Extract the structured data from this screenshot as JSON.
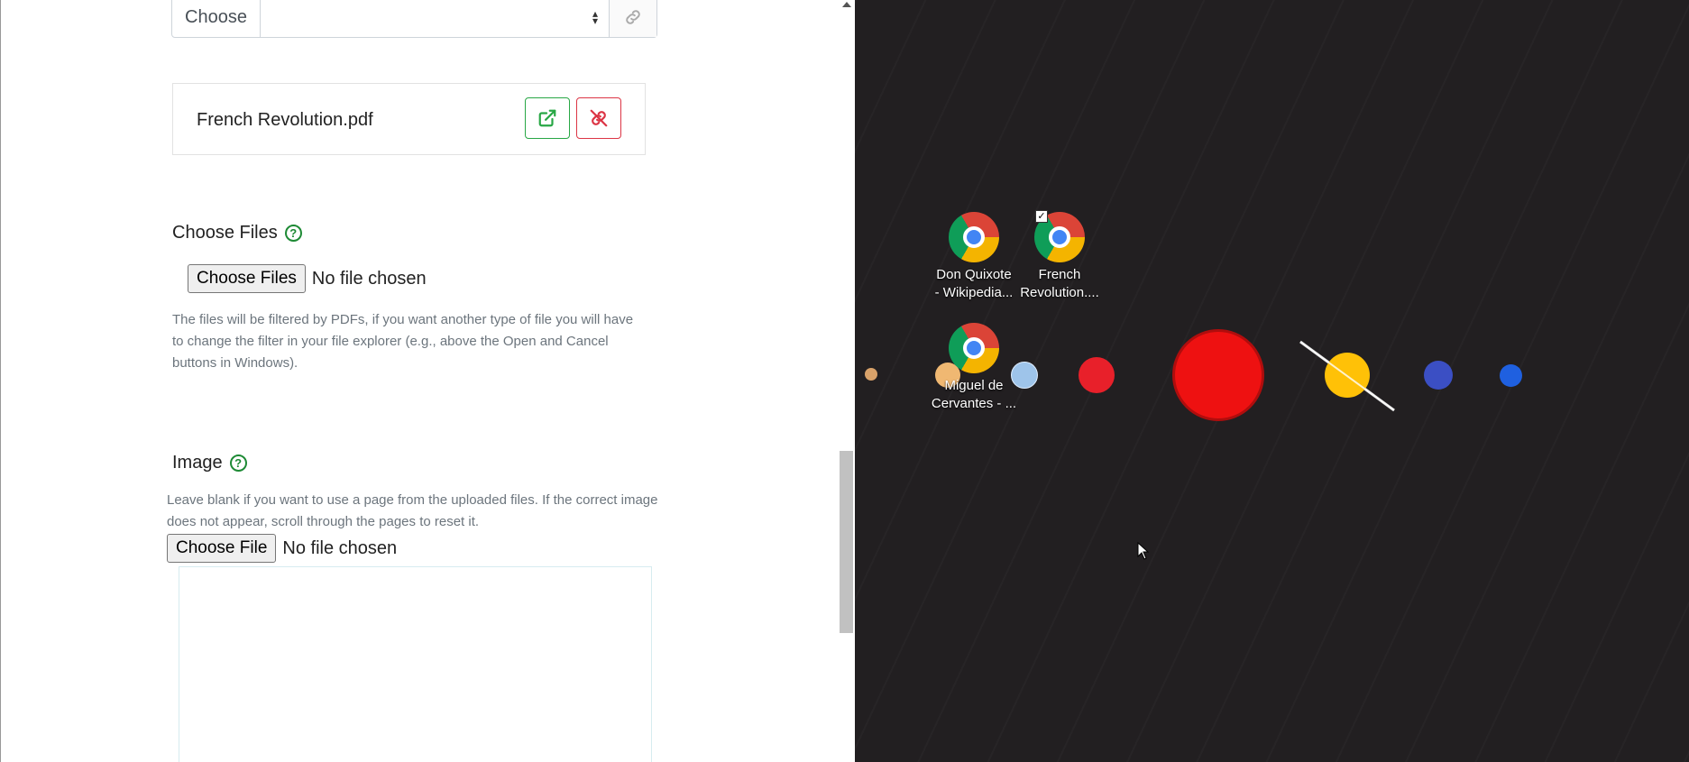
{
  "form": {
    "select_prefix": "Choose",
    "file_card": {
      "name": "French Revolution.pdf"
    },
    "choose_files": {
      "label": "Choose Files",
      "button": "Choose Files",
      "status": "No file chosen",
      "help": "The files will be filtered by PDFs, if you want another type of file you will have to change the filter in your file explorer (e.g., above the Open and Cancel buttons in Windows)."
    },
    "image": {
      "label": "Image",
      "help": "Leave blank if you want to use a page from the uploaded files. If the correct image does not appear, scroll through the pages to reset it.",
      "button": "Choose File",
      "status": "No file chosen"
    }
  },
  "desktop": {
    "icons": [
      {
        "label_line1": "Don Quixote",
        "label_line2": "- Wikipedia...",
        "icon": "chrome-icon"
      },
      {
        "label_line1": "French",
        "label_line2": "Revolution....",
        "icon": "chrome-icon"
      },
      {
        "label_line1": "Miguel de",
        "label_line2": "Cervantes - ...",
        "icon": "chrome-icon"
      }
    ]
  },
  "colors": {
    "success": "#28a745",
    "danger": "#dc3545",
    "help": "#1e8a35",
    "desktop_bg": "#221f21",
    "sun": "#ee1111"
  }
}
